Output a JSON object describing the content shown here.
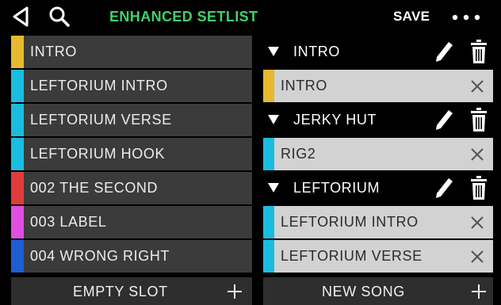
{
  "header": {
    "title": "ENHANCED SETLIST",
    "save_label": "SAVE",
    "icons": [
      "back-icon",
      "search-icon",
      "more-icon"
    ],
    "title_color": "#3fd16a"
  },
  "left_list": {
    "items": [
      {
        "label": "INTRO",
        "color": "#e6b92e"
      },
      {
        "label": "LEFTORIUM INTRO",
        "color": "#19bde0"
      },
      {
        "label": "LEFTORIUM VERSE",
        "color": "#19bde0"
      },
      {
        "label": "LEFTORIUM HOOK",
        "color": "#19bde0"
      },
      {
        "label": "002 THE SECOND",
        "color": "#e23b3b"
      },
      {
        "label": "003 LABEL",
        "color": "#e04fe0"
      },
      {
        "label": "004 WRONG RIGHT",
        "color": "#1e5ed2"
      }
    ]
  },
  "right_list": {
    "songs": [
      {
        "name": "INTRO",
        "presets": [
          {
            "label": "INTRO",
            "color": "#e6b92e"
          }
        ]
      },
      {
        "name": "JERKY HUT",
        "presets": [
          {
            "label": "RIG2",
            "color": "#19bde0"
          }
        ]
      },
      {
        "name": "LEFTORIUM",
        "presets": [
          {
            "label": "LEFTORIUM INTRO",
            "color": "#19bde0"
          },
          {
            "label": "LEFTORIUM VERSE",
            "color": "#19bde0"
          }
        ]
      }
    ]
  },
  "footer": {
    "empty_slot_label": "EMPTY SLOT",
    "new_song_label": "NEW SONG"
  }
}
